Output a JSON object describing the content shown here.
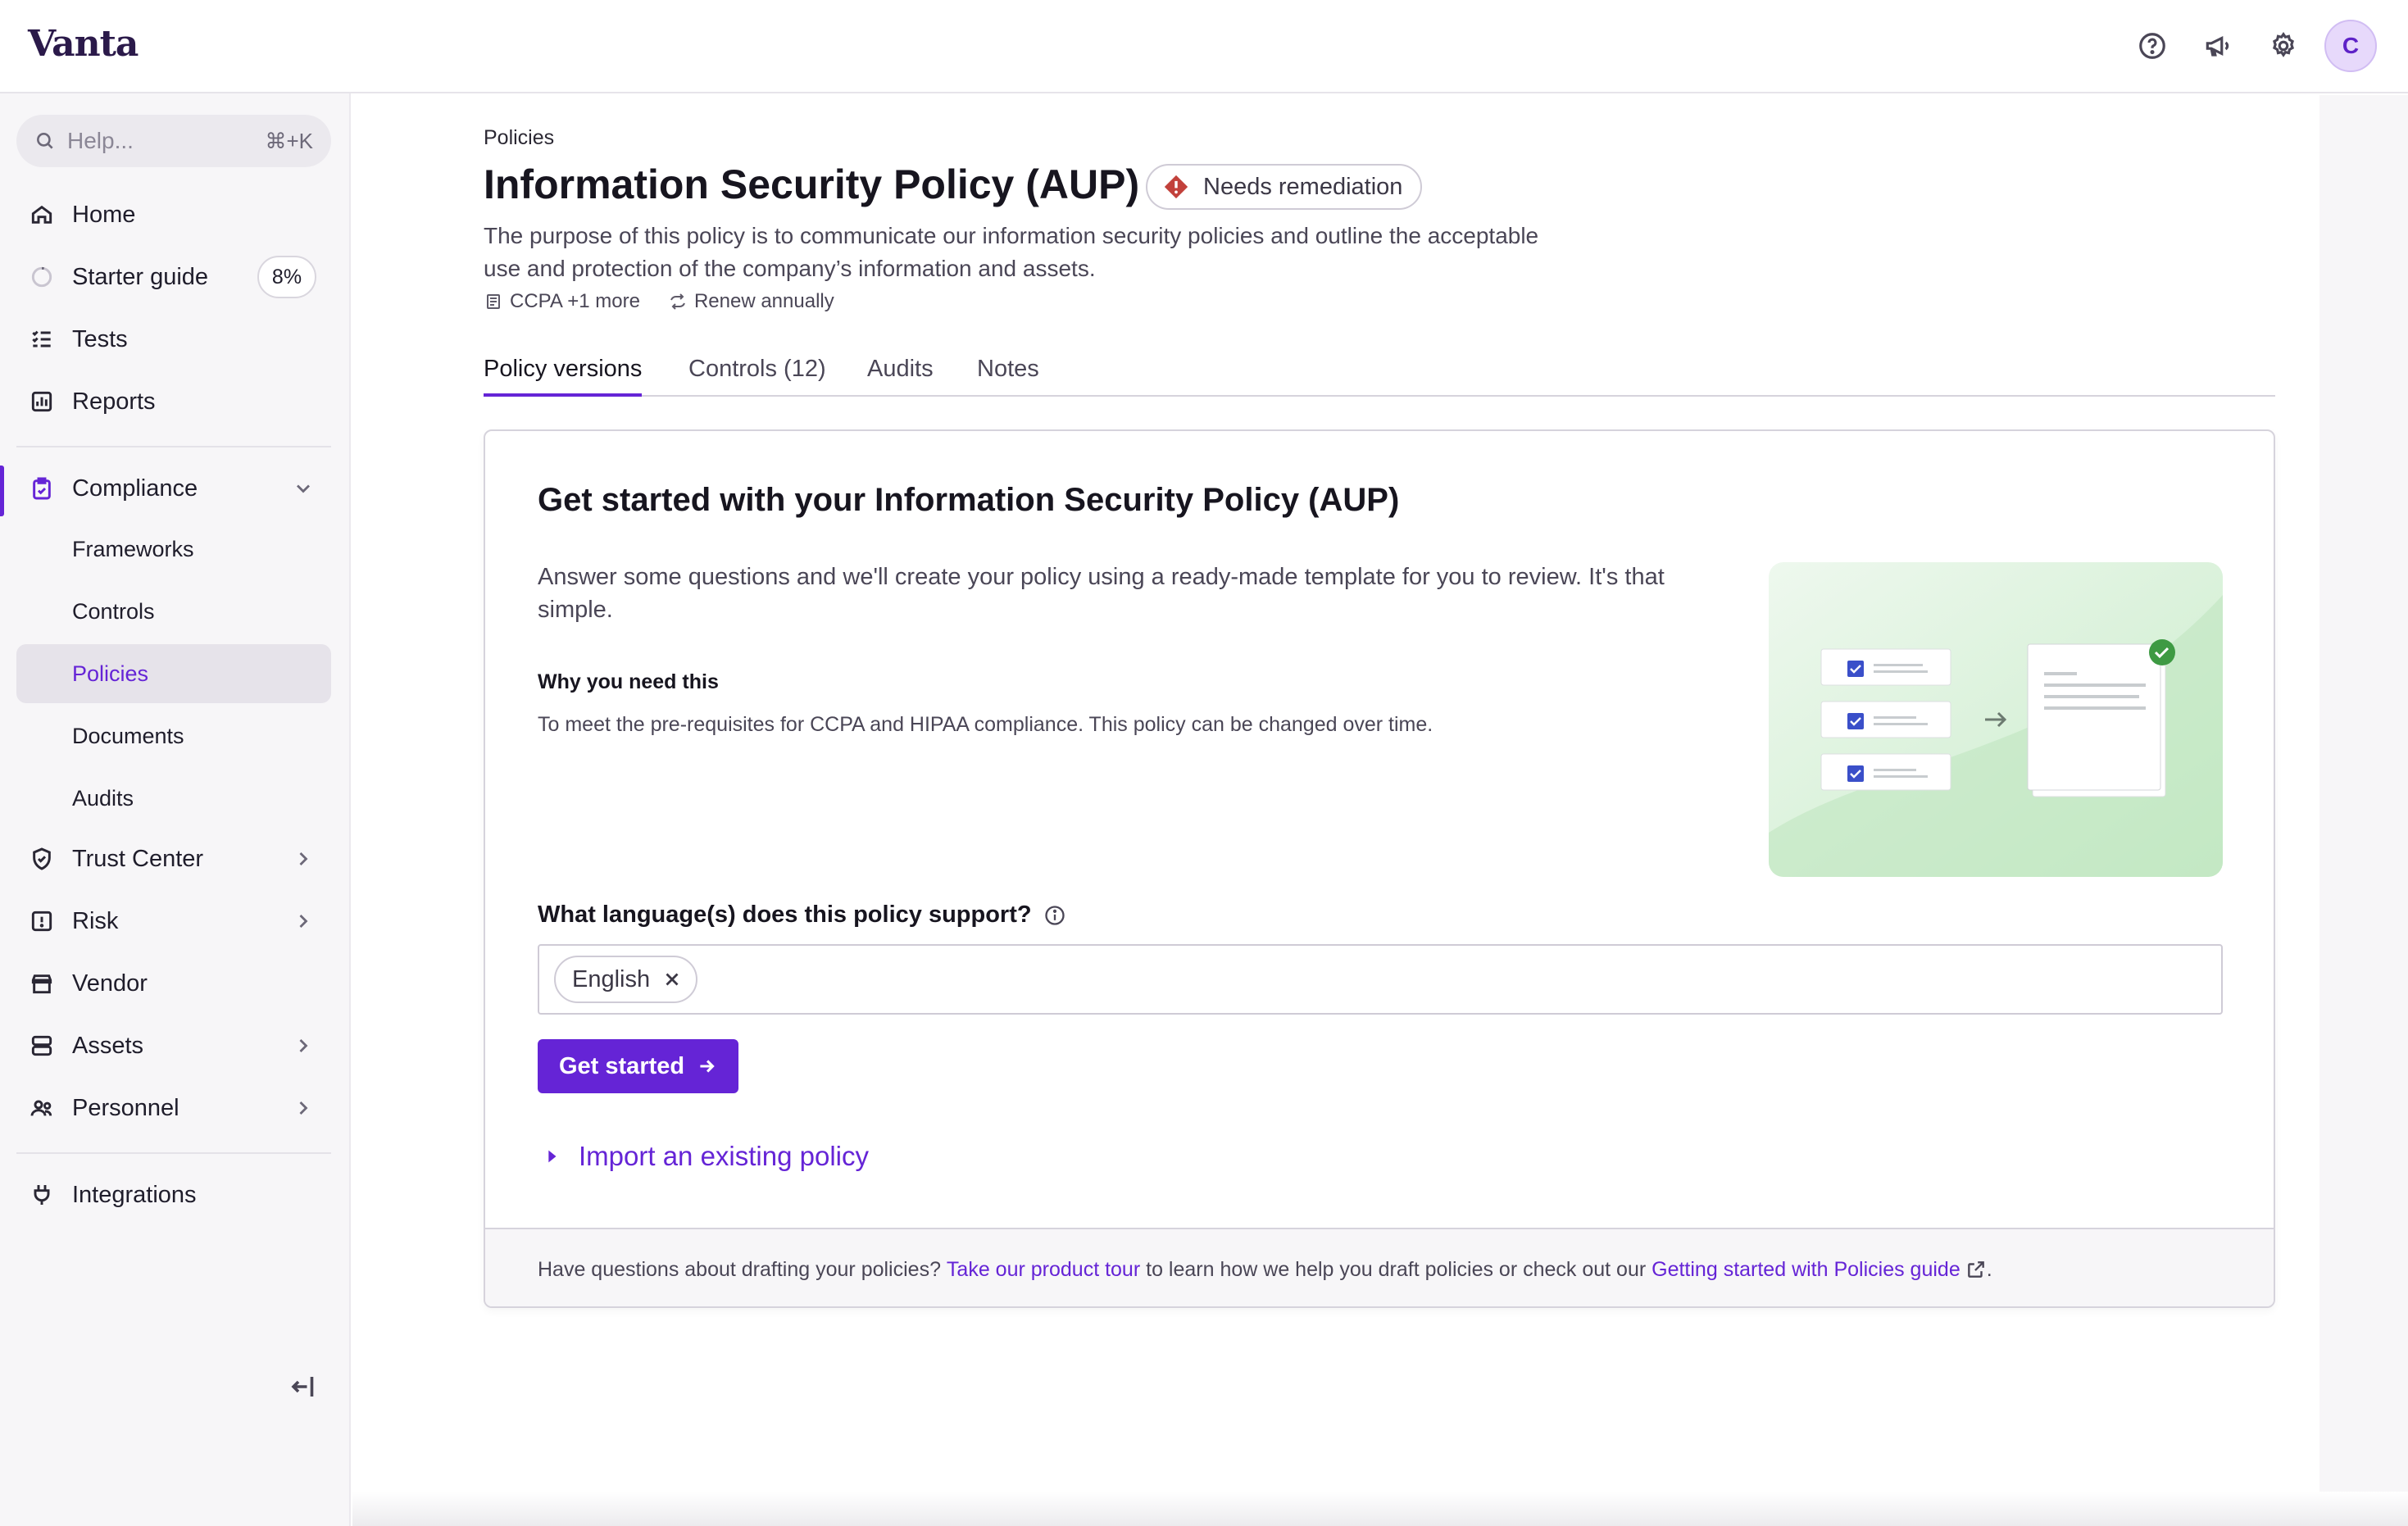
{
  "app": {
    "logo": "Vanta",
    "avatar_initial": "C",
    "accent": "#6524d6"
  },
  "topbar": {
    "icons": [
      "help-circle-icon",
      "megaphone-icon",
      "gear-icon",
      "avatar"
    ]
  },
  "sidebar": {
    "search_placeholder": "Help...",
    "search_shortcut": "⌘+K",
    "items": [
      {
        "label": "Home",
        "icon": "home-icon"
      },
      {
        "label": "Starter guide",
        "icon": "progress-ring-icon",
        "badge": "8%"
      },
      {
        "label": "Tests",
        "icon": "checklist-icon"
      },
      {
        "label": "Reports",
        "icon": "chart-icon"
      },
      {
        "label": "Compliance",
        "icon": "clipboard-check-icon",
        "expanded": true
      },
      {
        "label": "Frameworks"
      },
      {
        "label": "Controls"
      },
      {
        "label": "Policies",
        "active": true
      },
      {
        "label": "Documents"
      },
      {
        "label": "Audits"
      },
      {
        "label": "Trust Center",
        "icon": "shield-check-icon"
      },
      {
        "label": "Risk",
        "icon": "alert-square-icon"
      },
      {
        "label": "Vendor",
        "icon": "store-icon"
      },
      {
        "label": "Assets",
        "icon": "server-icon"
      },
      {
        "label": "Personnel",
        "icon": "users-icon"
      },
      {
        "label": "Integrations",
        "icon": "plug-icon"
      }
    ]
  },
  "page": {
    "breadcrumb": "Policies",
    "title": "Information Security Policy (AUP)",
    "status_badge": "Needs remediation",
    "description": "The purpose of this policy is to communicate our information security policies and outline the acceptable use and protection of the company’s information and assets.",
    "meta": {
      "frameworks": "CCPA +1 more",
      "renewal": "Renew annually"
    },
    "tabs": [
      "Policy versions",
      "Controls (12)",
      "Audits",
      "Notes"
    ]
  },
  "card": {
    "title": "Get started with your Information Security Policy (AUP)",
    "description": "Answer some questions and we'll create your policy using a ready-made template for you to review. It's that simple.",
    "why_heading": "Why you need this",
    "why_text": "To meet the pre-requisites for CCPA and HIPAA compliance. This policy can be changed over time.",
    "question": "What language(s) does this policy support?",
    "selected_language": "English",
    "cta": "Get started",
    "import_link": "Import an existing policy",
    "footer": {
      "text1": "Have questions about drafting your policies?",
      "link1": "Take our product tour",
      "text2": "to learn how we help you draft policies or check out our",
      "link2": "Getting started with Policies guide",
      "end": "."
    }
  }
}
